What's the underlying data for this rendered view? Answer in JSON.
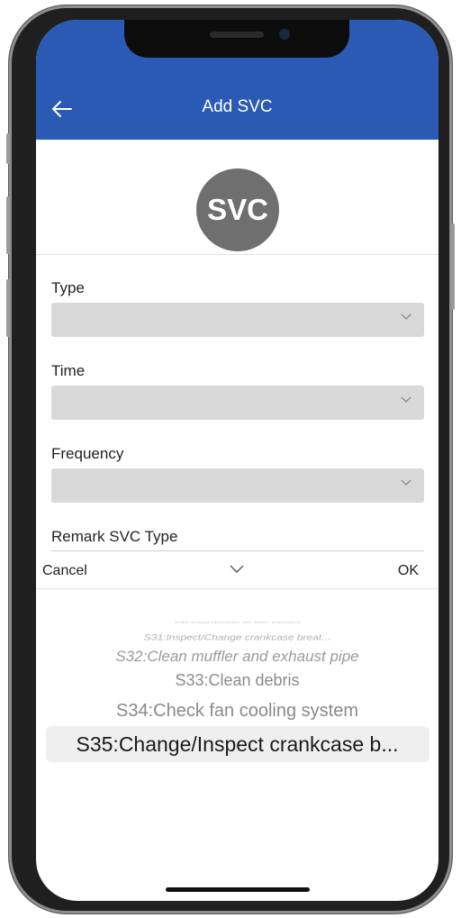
{
  "header": {
    "back_icon": "arrow-left-icon",
    "title": "Add SVC"
  },
  "avatar": {
    "text": "SVC",
    "color": "#6f6f6f"
  },
  "form": {
    "type_label": "Type",
    "type_value": "",
    "time_label": "Time",
    "time_value": "",
    "frequency_label": "Frequency",
    "frequency_value": "",
    "remark_label": "Remark SVC Type"
  },
  "picker": {
    "cancel_label": "Cancel",
    "ok_label": "OK",
    "collapse_icon": "chevron-down-icon",
    "options": [
      "S30:Inspect/Clean air filter element",
      "S31:Inspect/Change crankcase breat...",
      "S32:Clean muffler and exhaust pipe",
      "S33:Clean debris",
      "S34:Check fan cooling system",
      "S35:Change/Inspect crankcase b..."
    ],
    "selected_index": 5
  },
  "colors": {
    "header_bg": "#2a5ab4",
    "select_bg": "#d9d9d9",
    "selected_row_bg": "#efefef"
  }
}
